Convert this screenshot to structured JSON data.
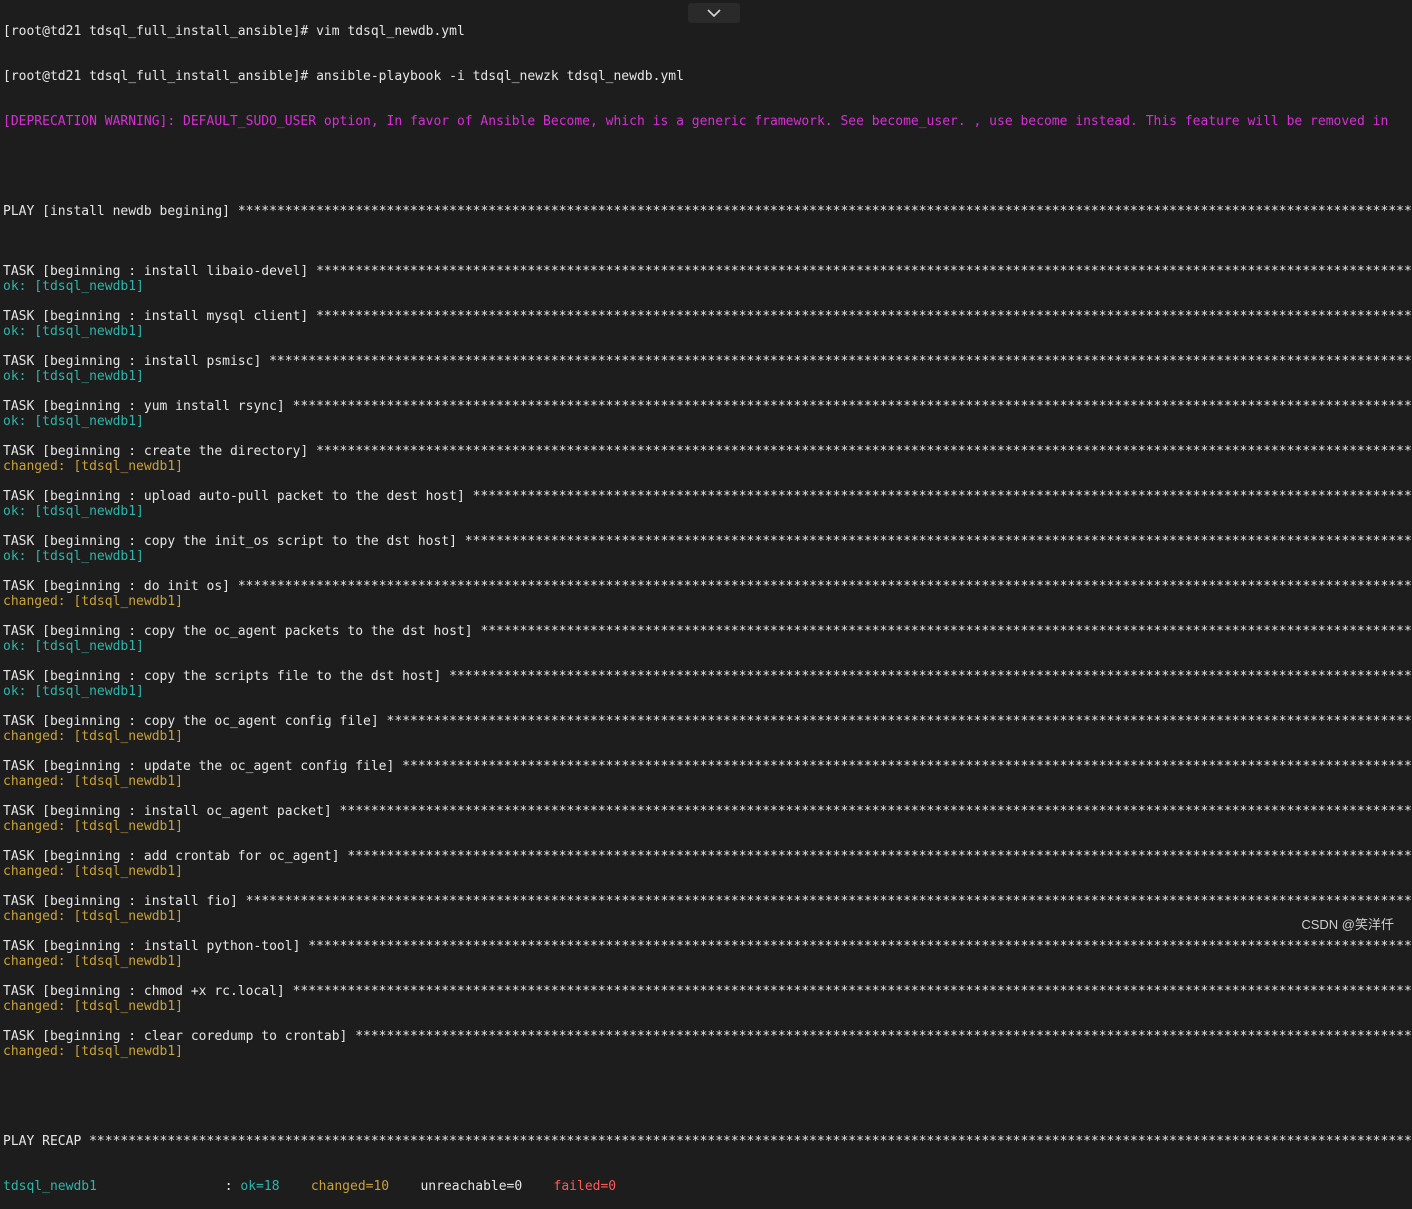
{
  "terminal": {
    "prompt_line_1": "[root@td21 tdsql_full_install_ansible]# vim tdsql_newdb.yml",
    "prompt_line_2": "[root@td21 tdsql_full_install_ansible]# ansible-playbook -i tdsql_newzk tdsql_newdb.yml",
    "deprecation_warning": "[DEPRECATION WARNING]: DEFAULT_SUDO_USER option, In favor of Ansible Become, which is a generic framework. See become_user. , use become instead. This feature will be removed in",
    "play_header": "PLAY [install newdb begining] ",
    "stars": "****************************************************************************************************************************************************************************************",
    "tasks": [
      {
        "header": "TASK [beginning : install libaio-devel] ",
        "status": "ok: [tdsql_newdb1]",
        "state": "ok"
      },
      {
        "header": "TASK [beginning : install mysql client] ",
        "status": "ok: [tdsql_newdb1]",
        "state": "ok"
      },
      {
        "header": "TASK [beginning : install psmisc] ",
        "status": "ok: [tdsql_newdb1]",
        "state": "ok"
      },
      {
        "header": "TASK [beginning : yum install rsync] ",
        "status": "ok: [tdsql_newdb1]",
        "state": "ok"
      },
      {
        "header": "TASK [beginning : create the directory] ",
        "status": "changed: [tdsql_newdb1]",
        "state": "changed"
      },
      {
        "header": "TASK [beginning : upload auto-pull packet to the dest host] ",
        "status": "ok: [tdsql_newdb1]",
        "state": "ok"
      },
      {
        "header": "TASK [beginning : copy the init_os script to the dst host] ",
        "status": "ok: [tdsql_newdb1]",
        "state": "ok"
      },
      {
        "header": "TASK [beginning : do init os] ",
        "status": "changed: [tdsql_newdb1]",
        "state": "changed"
      },
      {
        "header": "TASK [beginning : copy the oc_agent packets to the dst host] ",
        "status": "ok: [tdsql_newdb1]",
        "state": "ok"
      },
      {
        "header": "TASK [beginning : copy the scripts file to the dst host] ",
        "status": "ok: [tdsql_newdb1]",
        "state": "ok"
      },
      {
        "header": "TASK [beginning : copy the oc_agent config file] ",
        "status": "changed: [tdsql_newdb1]",
        "state": "changed"
      },
      {
        "header": "TASK [beginning : update the oc_agent config file] ",
        "status": "changed: [tdsql_newdb1]",
        "state": "changed"
      },
      {
        "header": "TASK [beginning : install oc_agent packet] ",
        "status": "changed: [tdsql_newdb1]",
        "state": "changed"
      },
      {
        "header": "TASK [beginning : add crontab for oc_agent] ",
        "status": "changed: [tdsql_newdb1]",
        "state": "changed"
      },
      {
        "header": "TASK [beginning : install fio] ",
        "status": "changed: [tdsql_newdb1]",
        "state": "changed"
      },
      {
        "header": "TASK [beginning : install python-tool] ",
        "status": "changed: [tdsql_newdb1]",
        "state": "changed"
      },
      {
        "header": "TASK [beginning : chmod +x rc.local] ",
        "status": "changed: [tdsql_newdb1]",
        "state": "changed"
      },
      {
        "header": "TASK [beginning : clear coredump to crontab] ",
        "status": "changed: [tdsql_newdb1]",
        "state": "changed"
      }
    ],
    "recap_header": "PLAY RECAP ",
    "recap": {
      "host": "tdsql_newdb1",
      "sep": " : ",
      "ok": "ok=18",
      "changed": "changed=10",
      "unreachable": "unreachable=0",
      "failed": "failed=0"
    }
  },
  "watermark": "CSDN @笑洋仟",
  "colors": {
    "background": "#1d1d1d",
    "ok": "#2fb5a9",
    "changed": "#c9a23a",
    "warning": "#d52fd5",
    "failed": "#ff5a5a"
  },
  "icons": {
    "scroll_toggle": "chevron-down-icon"
  }
}
